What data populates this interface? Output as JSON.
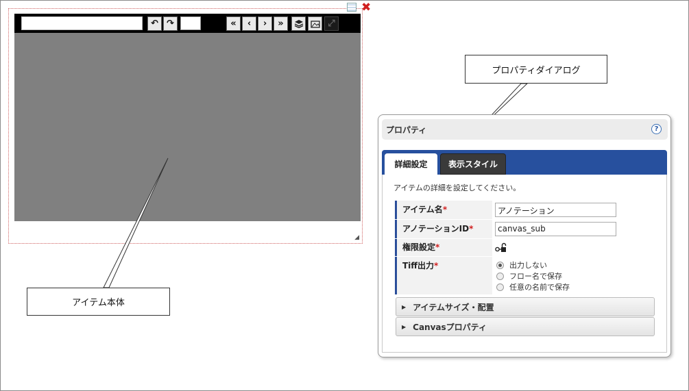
{
  "canvas_item": {
    "toolbar": {
      "buttons": [
        "undo-icon",
        "redo-icon",
        "first-page-icon",
        "prev-page-icon",
        "next-page-icon",
        "last-page-icon",
        "layers-icon",
        "image-icon",
        "fullscreen-icon"
      ]
    }
  },
  "callouts": {
    "item_body": "アイテム本体",
    "property_dialog": "プロパティダイアログ"
  },
  "dialog": {
    "title": "プロパティ",
    "help": "?",
    "tabs": [
      "詳細設定",
      "表示スタイル"
    ],
    "description": "アイテムの詳細を設定してください。",
    "fields": {
      "item_name": {
        "label": "アイテム名",
        "required": "*",
        "value": "アノテーション"
      },
      "annotation_id": {
        "label": "アノテーションID",
        "required": "*",
        "value": "canvas_sub"
      },
      "permission": {
        "label": "権限設定",
        "required": "*"
      },
      "tiff_output": {
        "label": "Tiff出力",
        "required": "*",
        "options": [
          "出力しない",
          "フロー名で保存",
          "任意の名前で保存"
        ],
        "selected": "出力しない"
      }
    },
    "sections": [
      "アイテムサイズ・配置",
      "Canvasプロパティ"
    ]
  },
  "colors": {
    "tab_bar": "#27509e",
    "canvas": "#808080",
    "required": "#d02020"
  }
}
